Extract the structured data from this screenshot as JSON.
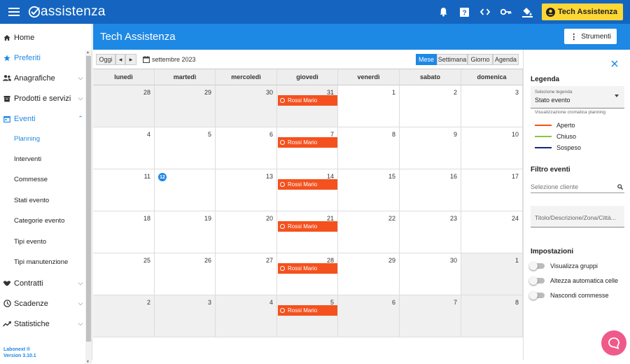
{
  "app": {
    "logo_text": "assistenza",
    "user_name": "Tech Assistenza"
  },
  "topbar": {
    "icons": [
      "bell-icon",
      "help-icon",
      "code-icon",
      "key-icon",
      "paint-bucket-icon",
      "account-icon"
    ]
  },
  "sidebar": {
    "items": [
      {
        "label": "Home",
        "icon": "home-icon"
      },
      {
        "label": "Preferiti",
        "icon": "star-icon"
      },
      {
        "label": "Anagrafiche",
        "icon": "people-icon"
      },
      {
        "label": "Prodotti e servizi",
        "icon": "box-icon"
      },
      {
        "label": "Eventi",
        "icon": "calendar-icon"
      },
      {
        "label": "Planning"
      },
      {
        "label": "Interventi"
      },
      {
        "label": "Commesse"
      },
      {
        "label": "Stati evento"
      },
      {
        "label": "Categorie evento"
      },
      {
        "label": "Tipi evento"
      },
      {
        "label": "Tipi manutenzione"
      },
      {
        "label": "Contratti",
        "icon": "handshake-icon"
      },
      {
        "label": "Scadenze",
        "icon": "clock-icon"
      },
      {
        "label": "Statistiche",
        "icon": "trend-icon"
      }
    ],
    "footer_line1": "Labonext ®",
    "footer_line2": "Version 3.10.1"
  },
  "page": {
    "title": "Tech Assistenza",
    "tools_button": "Strumenti"
  },
  "calendar": {
    "today_button": "Oggi",
    "month_label": "settembre 2023",
    "views": [
      "Mese",
      "Settimana",
      "Giorno",
      "Agenda"
    ],
    "active_view": "Mese",
    "weekdays": [
      "lunedì",
      "martedì",
      "mercoledì",
      "giovedì",
      "venerdì",
      "sabato",
      "domenica"
    ],
    "weeks": [
      [
        "28",
        "29",
        "30",
        "31",
        "1",
        "2",
        "3"
      ],
      [
        "4",
        "5",
        "6",
        "7",
        "8",
        "9",
        "10"
      ],
      [
        "11",
        "12",
        "13",
        "14",
        "15",
        "16",
        "17"
      ],
      [
        "18",
        "19",
        "20",
        "21",
        "22",
        "23",
        "24"
      ],
      [
        "25",
        "26",
        "27",
        "28",
        "29",
        "30",
        "1"
      ],
      [
        "2",
        "3",
        "4",
        "5",
        "6",
        "7",
        "8"
      ]
    ],
    "today": "12",
    "events": [
      {
        "week": 0,
        "day": 3,
        "label": "Rossi Mario"
      },
      {
        "week": 1,
        "day": 3,
        "label": "Rossi Mario"
      },
      {
        "week": 2,
        "day": 3,
        "label": "Rossi Mario"
      },
      {
        "week": 3,
        "day": 3,
        "label": "Rossi Mario"
      },
      {
        "week": 4,
        "day": 3,
        "label": "Rossi Mario"
      },
      {
        "week": 5,
        "day": 3,
        "label": "Rossi Mario"
      }
    ],
    "event_color": "#f4511e"
  },
  "panel": {
    "legend_title": "Legenda",
    "select_label": "Selezione legenda",
    "select_value": "Stato evento",
    "hint": "Visualizzazione cromatica planning",
    "legend": [
      {
        "label": "Aperto",
        "color": "#f4511e"
      },
      {
        "label": "Chiuso",
        "color": "#8bc34a"
      },
      {
        "label": "Sospeso",
        "color": "#1a237e"
      }
    ],
    "filter_title": "Filtro eventi",
    "client_placeholder": "Selezione cliente",
    "text_placeholder": "Titolo/Descrizione/Zona/Città...",
    "settings_title": "Impostazioni",
    "toggles": [
      "Visualizza gruppi",
      "Altezza automatica celle",
      "Nascondi commesse"
    ]
  }
}
